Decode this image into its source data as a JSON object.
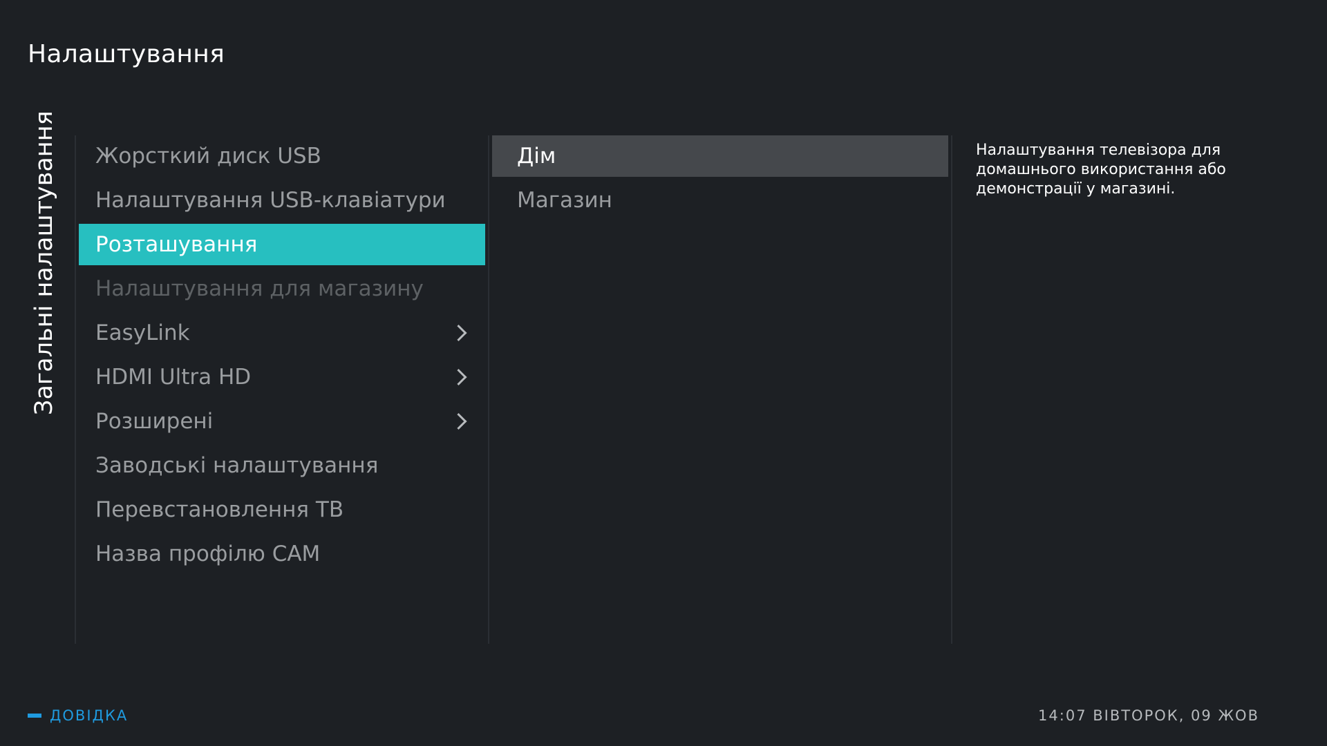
{
  "header": {
    "title": "Налаштування"
  },
  "section": {
    "label": "Загальні налаштування"
  },
  "menu": {
    "items": [
      {
        "label": "Жорсткий диск USB",
        "state": "normal",
        "submenu": false
      },
      {
        "label": "Налаштування USB-клавіатури",
        "state": "normal",
        "submenu": false
      },
      {
        "label": "Розташування",
        "state": "selected",
        "submenu": false
      },
      {
        "label": "Налаштування для магазину",
        "state": "disabled",
        "submenu": false
      },
      {
        "label": "EasyLink",
        "state": "normal",
        "submenu": true
      },
      {
        "label": "HDMI Ultra HD",
        "state": "normal",
        "submenu": true
      },
      {
        "label": "Розширені",
        "state": "normal",
        "submenu": true
      },
      {
        "label": "Заводські налаштування",
        "state": "normal",
        "submenu": false
      },
      {
        "label": "Перевстановлення ТВ",
        "state": "normal",
        "submenu": false
      },
      {
        "label": "Назва профілю CAM",
        "state": "normal",
        "submenu": false
      }
    ],
    "chevron_icon": "chevron-right-icon"
  },
  "options": {
    "items": [
      {
        "label": "Дім",
        "state": "focused"
      },
      {
        "label": "Магазин",
        "state": "normal"
      }
    ]
  },
  "description": {
    "text": "Налаштування телевізора для домашнього використання або демонстрації у магазині."
  },
  "footer": {
    "help_label": "ДОВІДКА",
    "help_color": "#1f9be0",
    "clock": "14:07 ВІВТОРОК, 09 ЖОВ"
  },
  "colors": {
    "background": "#1d2024",
    "accent": "#27bfc0",
    "focus": "#45484c"
  }
}
